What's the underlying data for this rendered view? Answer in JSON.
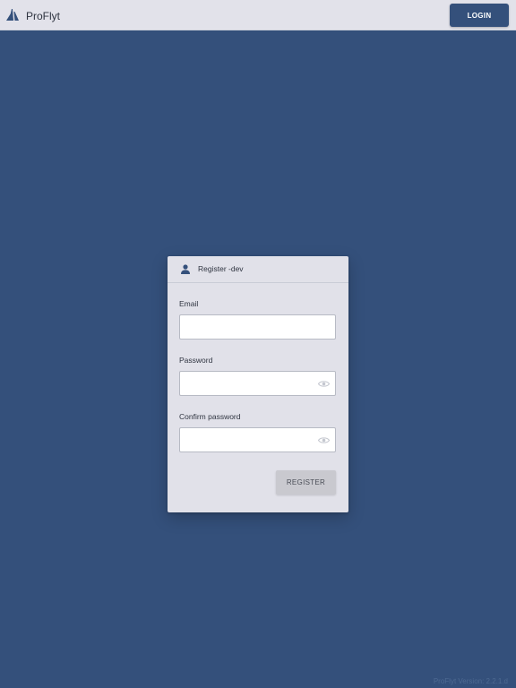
{
  "app": {
    "title": "ProFlyt",
    "logo_icon": "proflyt-sail-logo-icon",
    "brand_color": "#34507b"
  },
  "header": {
    "login_label": "LOGIN"
  },
  "register_card": {
    "title": "Register -dev",
    "title_icon": "user-icon",
    "fields": [
      {
        "label": "Email",
        "value": "",
        "placeholder": "",
        "icon": ""
      },
      {
        "label": "Password",
        "value": "",
        "placeholder": "",
        "icon": "eye-icon"
      },
      {
        "label": "Confirm password",
        "value": "",
        "placeholder": "",
        "icon": "eye-icon"
      }
    ],
    "register_label": "REGISTER"
  },
  "footer": {
    "version": "ProFlyt Version: 2.2.1.d"
  }
}
